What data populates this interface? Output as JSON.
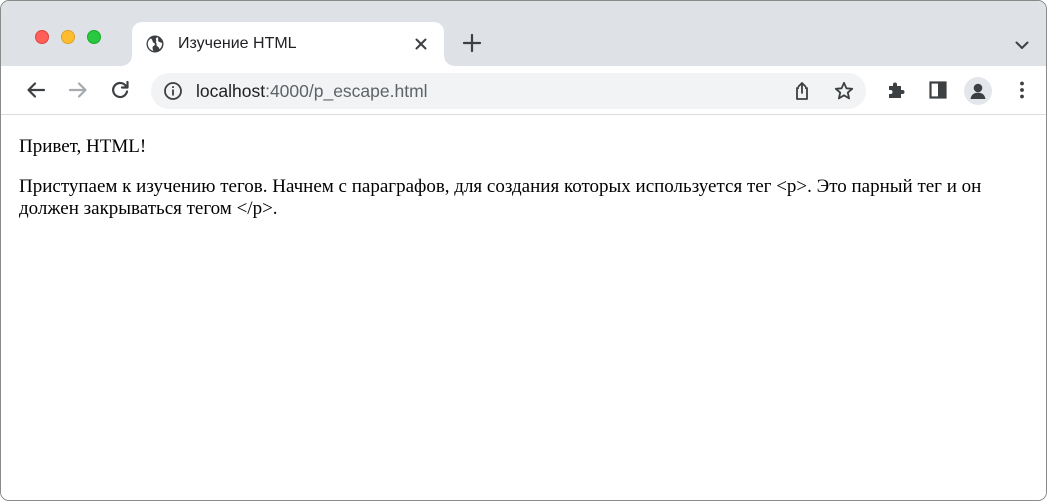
{
  "tab": {
    "title": "Изучение HTML"
  },
  "address_bar": {
    "host": "localhost",
    "path": ":4000/p_escape.html"
  },
  "page": {
    "paragraphs": [
      "Привет, HTML!",
      "Приступаем к изучению тегов. Начнем с параграфов, для создания которых используется тег <p>. Это парный тег и он должен закрываться тегом </p>."
    ]
  },
  "icons": {
    "tab_favicon": "globe-icon",
    "tab_close": "close-icon",
    "new_tab": "plus-icon",
    "tab_search": "chevron-down-icon",
    "back": "arrow-left-icon",
    "forward": "arrow-right-icon",
    "reload": "reload-icon",
    "site_info": "info-icon",
    "share": "share-icon",
    "bookmark": "star-icon",
    "extensions": "puzzle-icon",
    "side_panel": "side-panel-icon",
    "profile": "avatar-icon",
    "menu": "kebab-menu-icon"
  },
  "colors": {
    "tabstrip_bg": "#dee1e6",
    "omnibox_bg": "#f1f3f4",
    "close_button": "#ff5f57",
    "minimize_button": "#febc2e",
    "zoom_button": "#28c840"
  }
}
